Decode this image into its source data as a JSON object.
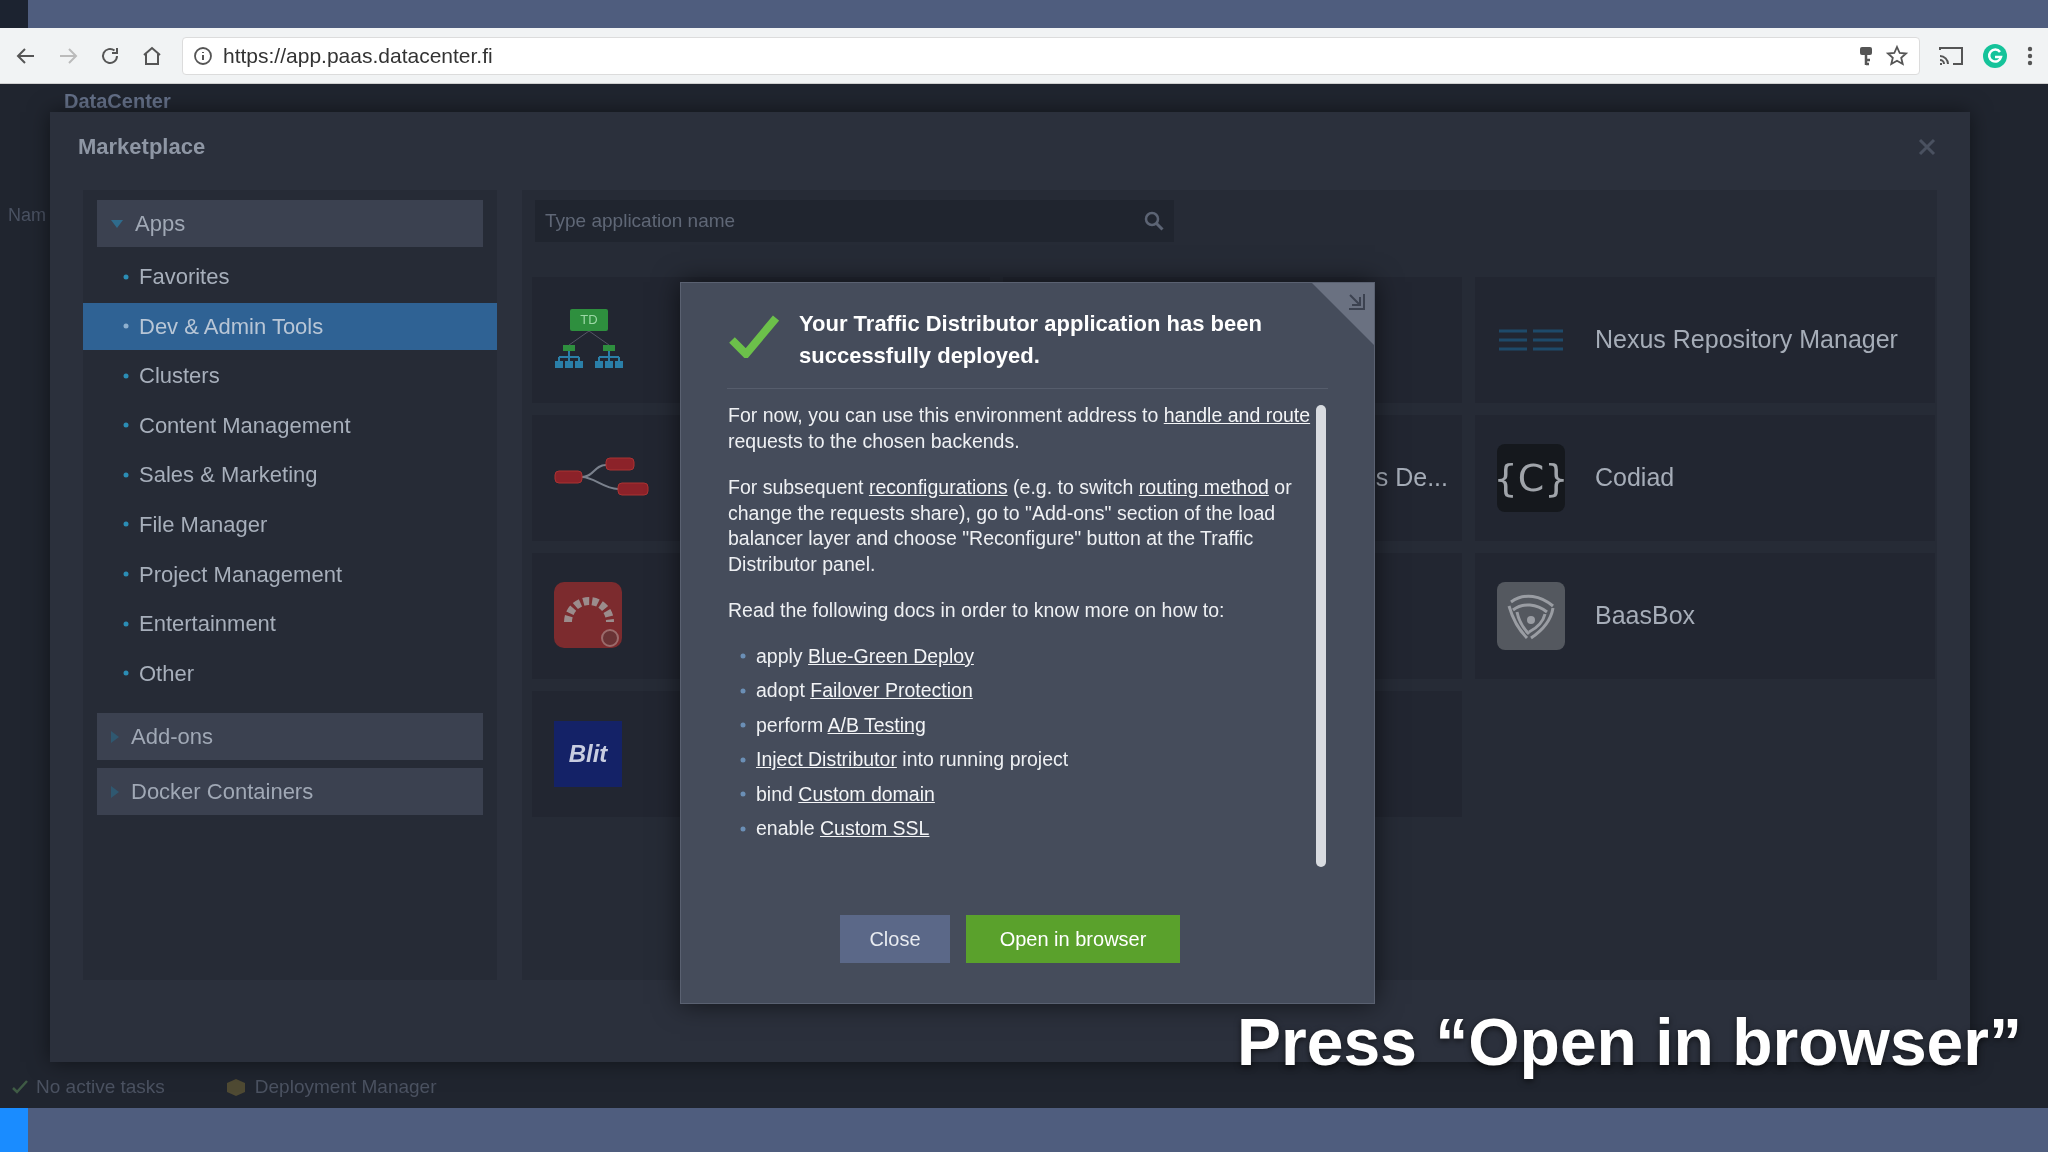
{
  "browser": {
    "url": "https://app.paas.datacenter.fi"
  },
  "background_app": {
    "logo": "DataCenter",
    "column_header": "Nam",
    "status_bar": [
      {
        "label": "No active tasks",
        "kind": "tasks"
      },
      {
        "label": "Deployment Manager",
        "kind": "deployments"
      }
    ]
  },
  "marketplace": {
    "title": "Marketplace",
    "categories": [
      {
        "label": "Apps",
        "expanded": true,
        "children": [
          {
            "label": "Favorites",
            "selected": false
          },
          {
            "label": "Dev & Admin Tools",
            "selected": true
          },
          {
            "label": "Clusters",
            "selected": false
          },
          {
            "label": "Content Management",
            "selected": false
          },
          {
            "label": "Sales & Marketing",
            "selected": false
          },
          {
            "label": "File Manager",
            "selected": false
          },
          {
            "label": "Project Management",
            "selected": false
          },
          {
            "label": "Entertainment",
            "selected": false
          },
          {
            "label": "Other",
            "selected": false
          }
        ]
      },
      {
        "label": "Add-ons",
        "expanded": false
      },
      {
        "label": "Docker Containers",
        "expanded": false
      }
    ],
    "search": {
      "placeholder": "Type application name"
    },
    "app_rows": [
      [
        {
          "kind": "tree",
          "badge": "TD"
        },
        {
          "kind": "blank"
        },
        {
          "kind": "stripes",
          "label": "Nexus Repository Manager"
        }
      ],
      [
        {
          "kind": "nodes"
        },
        {
          "kind": "text",
          "label": "s De..."
        },
        {
          "kind": "codiad",
          "logo_text": "{C}",
          "label": "Codiad"
        }
      ],
      [
        {
          "kind": "gauge"
        },
        {
          "kind": "blank"
        },
        {
          "kind": "swirl",
          "label": "BaasBox"
        }
      ],
      [
        {
          "kind": "blit",
          "logo_text": "Blit"
        },
        {
          "kind": "blank"
        }
      ]
    ]
  },
  "dialog": {
    "title": "Your Traffic Distributor application has been successfully deployed.",
    "paragraphs": [
      [
        {
          "text": "For now, you can use this environment address to ",
          "link": false
        },
        {
          "text": "handle and route",
          "link": true
        },
        {
          "text": " requests to the chosen backends.",
          "link": false
        }
      ],
      [
        {
          "text": "For subsequent ",
          "link": false
        },
        {
          "text": "reconfigurations",
          "link": true
        },
        {
          "text": " (e.g. to switch ",
          "link": false
        },
        {
          "text": "routing method",
          "link": true
        },
        {
          "text": " or change the requests share), go to \"Add-ons\" section of the load balancer layer and choose \"Reconfigure\" button at the Traffic Distributor panel.",
          "link": false
        }
      ],
      [
        {
          "text": "Read the following docs in order to know more on how to:",
          "link": false
        }
      ]
    ],
    "doc_list": [
      [
        {
          "text": "apply ",
          "link": false
        },
        {
          "text": "Blue-Green Deploy",
          "link": true
        }
      ],
      [
        {
          "text": "adopt ",
          "link": false
        },
        {
          "text": "Failover Protection",
          "link": true
        }
      ],
      [
        {
          "text": "perform ",
          "link": false
        },
        {
          "text": "A/B Testing",
          "link": true
        }
      ],
      [
        {
          "text": "Inject Distributor",
          "link": true
        },
        {
          "text": " into running project",
          "link": false
        }
      ],
      [
        {
          "text": "bind ",
          "link": false
        },
        {
          "text": "Custom domain",
          "link": true
        }
      ],
      [
        {
          "text": "enable ",
          "link": false
        },
        {
          "text": "Custom SSL",
          "link": true
        }
      ]
    ],
    "buttons": [
      {
        "label": "Close",
        "kind": "secondary"
      },
      {
        "label": "Open in browser",
        "kind": "primary"
      }
    ]
  },
  "caption": "Press “Open in browser”"
}
